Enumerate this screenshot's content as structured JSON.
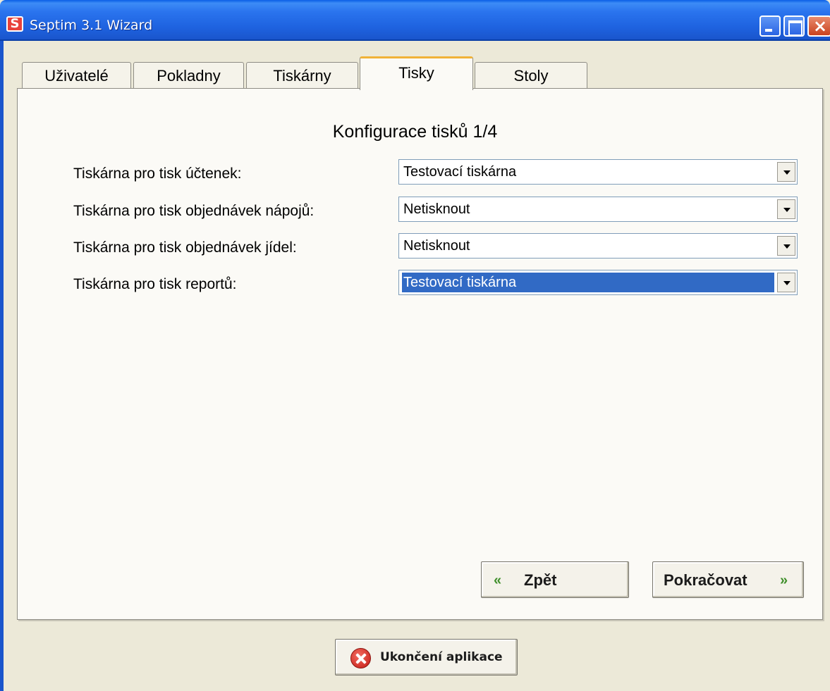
{
  "window": {
    "title": "Septim 3.1 Wizard",
    "logo_letter": "S"
  },
  "tabs": [
    {
      "label": "Uživatelé",
      "selected": false
    },
    {
      "label": "Pokladny",
      "selected": false
    },
    {
      "label": "Tiskárny",
      "selected": false
    },
    {
      "label": "Tisky",
      "selected": true
    },
    {
      "label": "Stoly",
      "selected": false
    }
  ],
  "panel": {
    "title": "Konfigurace tisků 1/4",
    "rows": [
      {
        "label": "Tiskárna pro tisk účtenek:",
        "value": "Testovací tiskárna"
      },
      {
        "label": "Tiskárna pro tisk objednávek nápojů:",
        "value": "Netisknout"
      },
      {
        "label": "Tiskárna pro tisk objednávek jídel:",
        "value": "Netisknout"
      },
      {
        "label": "Tiskárna pro tisk reportů:",
        "value": "Testovací tiskárna"
      }
    ],
    "back_label": "Zpět",
    "next_label": "Pokračovat",
    "chevrons_back": "«",
    "chevrons_next": "»"
  },
  "footer": {
    "exit_label": "Ukončení aplikace"
  },
  "icons": {
    "back": "double-chevron-left-icon",
    "next": "double-chevron-right-icon",
    "exit": "red-x-circle-icon"
  },
  "colors": {
    "titlebar": "#2A74EE",
    "selected_tab_accent": "#F0B238",
    "focused_combo": "#316AC5",
    "chevron": "#3E8F2A"
  }
}
